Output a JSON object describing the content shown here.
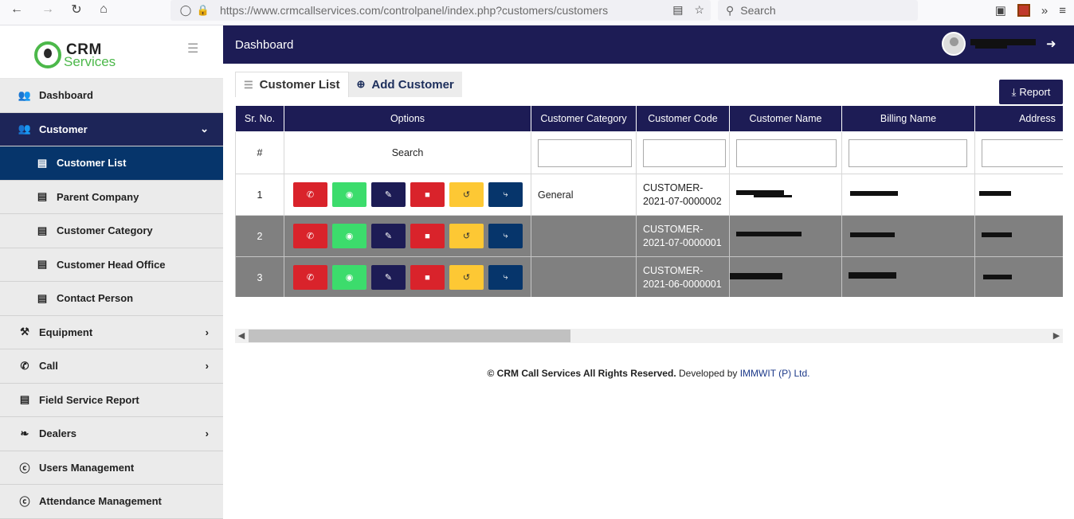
{
  "browser": {
    "url": "https://www.crmcallservices.com/controlpanel/index.php?customers/customers",
    "search_placeholder": "Search"
  },
  "brand": {
    "line1": "CRM",
    "line2": "Services"
  },
  "sidebar": {
    "items": [
      {
        "label": "Dashboard",
        "icon": "users-icon"
      },
      {
        "label": "Customer",
        "icon": "users-icon"
      },
      {
        "label": "Customer List",
        "icon": "doc-icon"
      },
      {
        "label": "Parent Company",
        "icon": "doc-icon"
      },
      {
        "label": "Customer Category",
        "icon": "doc-icon"
      },
      {
        "label": "Customer Head Office",
        "icon": "doc-icon"
      },
      {
        "label": "Contact Person",
        "icon": "doc-icon"
      },
      {
        "label": "Equipment",
        "icon": "tools-icon"
      },
      {
        "label": "Call",
        "icon": "phone-icon"
      },
      {
        "label": "Field Service Report",
        "icon": "doc-icon"
      },
      {
        "label": "Dealers",
        "icon": "leaf-icon"
      },
      {
        "label": "Users Management",
        "icon": "cc-icon"
      },
      {
        "label": "Attendance Management",
        "icon": "cc-icon"
      }
    ]
  },
  "header": {
    "title": "Dashboard"
  },
  "tabs": {
    "list": "Customer List",
    "add": "Add Customer"
  },
  "actions": {
    "report": "Report"
  },
  "table": {
    "headers": [
      "Sr. No.",
      "Options",
      "Customer Category",
      "Customer Code",
      "Customer Name",
      "Billing Name",
      "Address"
    ],
    "search_row": {
      "sr": "#",
      "options": "Search"
    },
    "rows": [
      {
        "sr": "1",
        "category": "General",
        "code_line1": "CUSTOMER-",
        "code_line2": "2021-07-0000002"
      },
      {
        "sr": "2",
        "category": "",
        "code_line1": "CUSTOMER-",
        "code_line2": "2021-07-0000001"
      },
      {
        "sr": "3",
        "category": "",
        "code_line1": "CUSTOMER-",
        "code_line2": "2021-06-0000001"
      }
    ]
  },
  "footer": {
    "copyright": "© CRM Call Services All Rights Reserved.",
    "developed": " Developed by ",
    "company": "IMMWIT (P) Ltd."
  },
  "colors": {
    "header_bg": "#1d1c55",
    "active_sub": "#06356b",
    "brand_green": "#4cb84a"
  }
}
